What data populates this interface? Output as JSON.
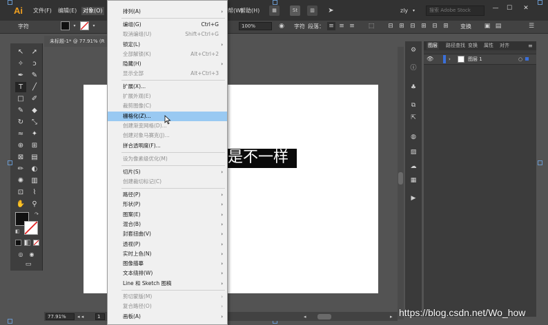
{
  "app": {
    "logo": "Ai"
  },
  "menubar": {
    "items": [
      "文件(F)",
      "编辑(E)",
      "对象(O)",
      "帮(W)",
      "帮助(H)"
    ],
    "active": "对象(O)",
    "right_icon_label": "St",
    "user": "zly",
    "search_placeholder": "搜索 Adobe Stock",
    "window_buttons": [
      "—",
      "☐",
      "✕"
    ]
  },
  "controlbar": {
    "mode_label": "字符",
    "fill_color": "#111111",
    "stroke_color": "#ffffff",
    "opacity_value": "100%",
    "char_label": "字符",
    "para_label": "段落：",
    "transform_label": "变换"
  },
  "document": {
    "tab_title": "未标题-1* @ 77.91% (R",
    "art_text": "是不一样",
    "zoom": "77.91%",
    "page": "1"
  },
  "panel": {
    "tabs": [
      "图层",
      "路径查找",
      "变换",
      "属性",
      "对齐"
    ],
    "active_tab": "图层",
    "layer_name": "图层 1"
  },
  "object_menu": {
    "items": [
      {
        "label": "排列(A)",
        "shortcut": "",
        "submenu": true,
        "enabled": true
      },
      {
        "label": "编组(G)",
        "shortcut": "Ctrl+G",
        "submenu": false,
        "enabled": true
      },
      {
        "label": "取消编组(U)",
        "shortcut": "Shift+Ctrl+G",
        "submenu": false,
        "enabled": false
      },
      {
        "label": "锁定(L)",
        "shortcut": "",
        "submenu": true,
        "enabled": true
      },
      {
        "label": "全部解锁(K)",
        "shortcut": "Alt+Ctrl+2",
        "submenu": false,
        "enabled": false
      },
      {
        "label": "隐藏(H)",
        "shortcut": "",
        "submenu": true,
        "enabled": true
      },
      {
        "label": "显示全部",
        "shortcut": "Alt+Ctrl+3",
        "submenu": false,
        "enabled": false
      },
      {
        "label": "扩展(X)...",
        "shortcut": "",
        "submenu": false,
        "enabled": true
      },
      {
        "label": "扩展外观(E)",
        "shortcut": "",
        "submenu": false,
        "enabled": false
      },
      {
        "label": "裁剪图像(C)",
        "shortcut": "",
        "submenu": false,
        "enabled": false
      },
      {
        "label": "栅格化(Z)...",
        "shortcut": "",
        "submenu": false,
        "enabled": true,
        "highlighted": true
      },
      {
        "label": "创建渐变网格(D)...",
        "shortcut": "",
        "submenu": false,
        "enabled": false
      },
      {
        "label": "创建对象马赛克(J)...",
        "shortcut": "",
        "submenu": false,
        "enabled": false
      },
      {
        "label": "拼合透明度(F)...",
        "shortcut": "",
        "submenu": false,
        "enabled": true
      },
      {
        "label": "设为像素级优化(M)",
        "shortcut": "",
        "submenu": false,
        "enabled": false
      },
      {
        "label": "切片(S)",
        "shortcut": "",
        "submenu": true,
        "enabled": true
      },
      {
        "label": "创建裁切标记(C)",
        "shortcut": "",
        "submenu": false,
        "enabled": false
      },
      {
        "label": "路径(P)",
        "shortcut": "",
        "submenu": true,
        "enabled": true
      },
      {
        "label": "形状(P)",
        "shortcut": "",
        "submenu": true,
        "enabled": true
      },
      {
        "label": "图案(E)",
        "shortcut": "",
        "submenu": true,
        "enabled": true
      },
      {
        "label": "混合(B)",
        "shortcut": "",
        "submenu": true,
        "enabled": true
      },
      {
        "label": "封套扭曲(V)",
        "shortcut": "",
        "submenu": true,
        "enabled": true
      },
      {
        "label": "透视(P)",
        "shortcut": "",
        "submenu": true,
        "enabled": true
      },
      {
        "label": "实时上色(N)",
        "shortcut": "",
        "submenu": true,
        "enabled": true
      },
      {
        "label": "图像描摹",
        "shortcut": "",
        "submenu": true,
        "enabled": true
      },
      {
        "label": "文本绕排(W)",
        "shortcut": "",
        "submenu": true,
        "enabled": true
      },
      {
        "label": "Line 和 Sketch 图稿",
        "shortcut": "",
        "submenu": true,
        "enabled": true
      },
      {
        "label": "剪切蒙版(M)",
        "shortcut": "",
        "submenu": true,
        "enabled": false
      },
      {
        "label": "复合路径(O)",
        "shortcut": "",
        "submenu": true,
        "enabled": false
      },
      {
        "label": "画板(A)",
        "shortcut": "",
        "submenu": true,
        "enabled": true
      }
    ]
  },
  "watermark": "https://blog.csdn.net/Wo_how"
}
